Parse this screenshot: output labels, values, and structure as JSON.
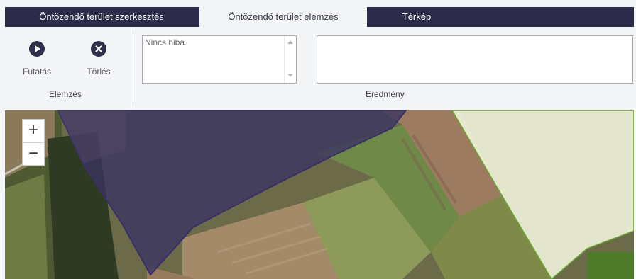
{
  "tabs": [
    {
      "label": "Öntözendő terület szerkesztés",
      "active": false
    },
    {
      "label": "Öntözendő terület elemzés",
      "active": true
    },
    {
      "label": "Térkép",
      "active": false
    }
  ],
  "ribbon": {
    "run_label": "Futatás",
    "clear_label": "Törlés",
    "analysis_group_label": "Elemzés",
    "error_text": "Nincs hiba.",
    "result_group_label": "Eredmény",
    "result_text": ""
  },
  "map": {
    "zoom_in": "+",
    "zoom_out": "−"
  },
  "colors": {
    "tab_bar": "#2c2c4a",
    "ribbon_bg": "#f4f5f7",
    "icon_dark": "#2e2e48",
    "selected_parcel": "#3a3360",
    "highlight_parcel": "#eef1d8"
  }
}
